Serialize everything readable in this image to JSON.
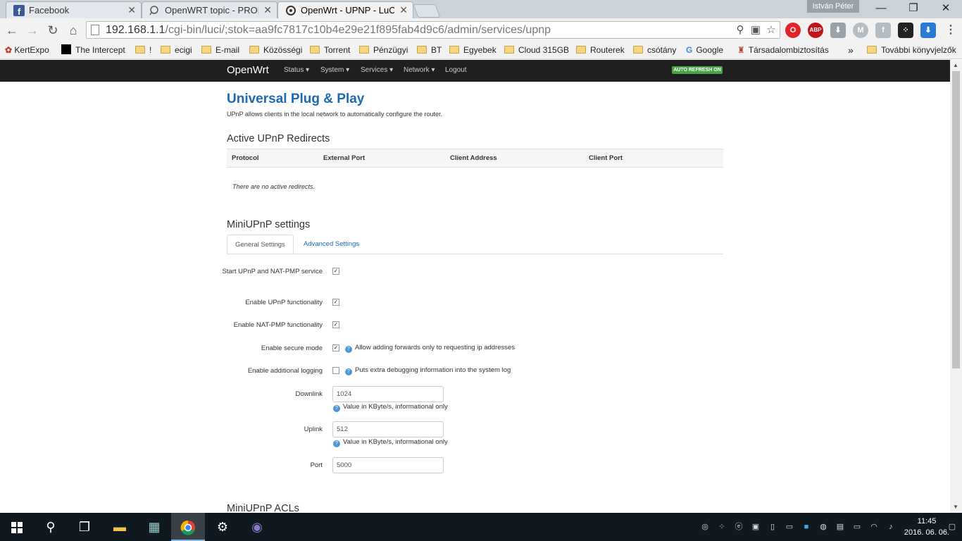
{
  "browser": {
    "tabs": [
      {
        "title": "Facebook",
        "icon": "facebook-icon"
      },
      {
        "title": "OpenWRT topic - PROHAR",
        "icon": "forum-icon"
      },
      {
        "title": "OpenWrt - UPNP - LuCI",
        "icon": "openwrt-icon",
        "active": true
      }
    ],
    "profile_name": "István Péter",
    "url_host": "192.168.1.1",
    "url_path": "/cgi-bin/luci/;stok=aa9fc7817c10b4e29e21f895fab4d9c6/admin/services/upnp",
    "extensions": [
      "opera-icon",
      "adblock-icon",
      "download-icon",
      "m-icon",
      "facebook-ext-icon",
      "blackberry-icon",
      "download-blue-icon"
    ],
    "adblock_label": "ABP",
    "bookmarks": [
      {
        "label": "KertExpo",
        "type": "site"
      },
      {
        "label": "The Intercept",
        "type": "site"
      },
      {
        "label": "!",
        "type": "folder"
      },
      {
        "label": "ecigi",
        "type": "folder"
      },
      {
        "label": "E-mail",
        "type": "folder"
      },
      {
        "label": "Közösségi",
        "type": "folder"
      },
      {
        "label": "Torrent",
        "type": "folder"
      },
      {
        "label": "Pénzügyi",
        "type": "folder"
      },
      {
        "label": "BT",
        "type": "folder"
      },
      {
        "label": "Egyebek",
        "type": "folder"
      },
      {
        "label": "Cloud 315GB",
        "type": "folder"
      },
      {
        "label": "Routerek",
        "type": "folder"
      },
      {
        "label": "csótány",
        "type": "folder"
      },
      {
        "label": "Google",
        "type": "site"
      },
      {
        "label": "Társadalombiztosítási",
        "type": "site"
      }
    ],
    "bookmarks_overflow": "»",
    "other_bookmarks": "További könyvjelzők"
  },
  "luci": {
    "brand": "OpenWrt",
    "menu": [
      "Status",
      "System",
      "Services",
      "Network",
      "Logout"
    ],
    "auto_refresh": "AUTO REFRESH ON",
    "page_title": "Universal Plug & Play",
    "page_description": "UPnP allows clients in the local network to automatically configure the router.",
    "redirects_title": "Active UPnP Redirects",
    "redirects_columns": [
      "Protocol",
      "External Port",
      "Client Address",
      "Client Port"
    ],
    "no_redirects": "There are no active redirects.",
    "settings_title": "MiniUPnP settings",
    "settings_tabs": [
      "General Settings",
      "Advanced Settings"
    ],
    "fields": {
      "start_service": {
        "label": "Start UPnP and NAT-PMP service",
        "checked": true
      },
      "enable_upnp": {
        "label": "Enable UPnP functionality",
        "checked": true
      },
      "enable_natpmp": {
        "label": "Enable NAT-PMP functionality",
        "checked": true
      },
      "secure_mode": {
        "label": "Enable secure mode",
        "checked": true,
        "hint": "Allow adding forwards only to requesting ip addresses"
      },
      "logging": {
        "label": "Enable additional logging",
        "checked": false,
        "hint": "Puts extra debugging information into the system log"
      },
      "downlink": {
        "label": "Downlink",
        "value": "1024",
        "hint": "Value in KByte/s, informational only"
      },
      "uplink": {
        "label": "Uplink",
        "value": "512",
        "hint": "Value in KByte/s, informational only"
      },
      "port": {
        "label": "Port",
        "value": "5000"
      }
    },
    "acl_title": "MiniUPnP ACLs"
  },
  "taskbar": {
    "apps": [
      "windows-start-icon",
      "search-icon",
      "task-view-icon",
      "file-explorer-icon",
      "photos-app-icon",
      "chrome-icon",
      "settings-icon",
      "bittorrent-icon"
    ],
    "clock_time": "11:45",
    "clock_date": "2016. 06. 06."
  },
  "colors": {
    "link_blue": "#1c6ab4",
    "navbar": "#1f1f1f",
    "refresh_badge": "#46a546"
  }
}
